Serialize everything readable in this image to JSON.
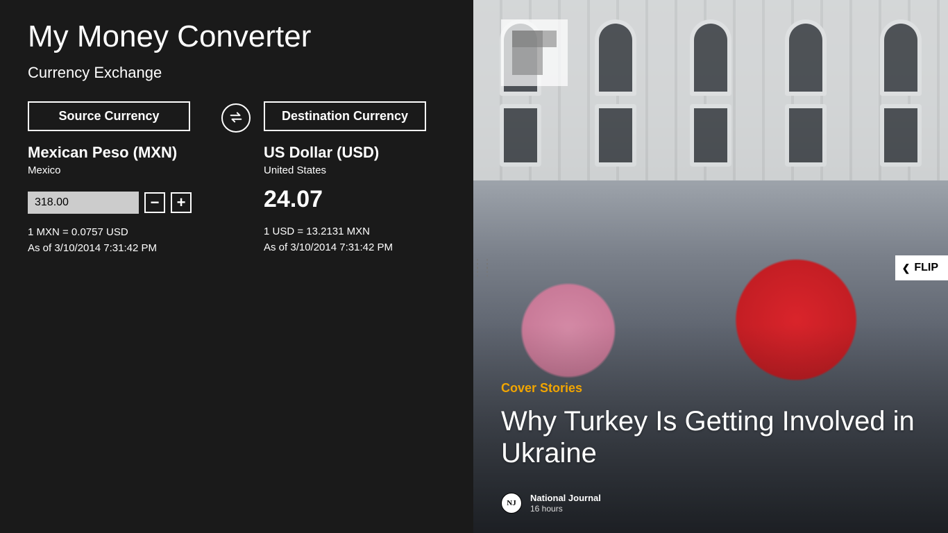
{
  "app_title": "My Money Converter",
  "subtitle": "Currency Exchange",
  "source": {
    "button_label": "Source Currency",
    "currency_name": "Mexican Peso (MXN)",
    "country": "Mexico",
    "amount": "318.00",
    "rate_line": "1 MXN = 0.0757 USD",
    "timestamp": "As of 3/10/2014 7:31:42 PM"
  },
  "dest": {
    "button_label": "Destination Currency",
    "currency_name": "US Dollar (USD)",
    "country": "United States",
    "result": "24.07",
    "rate_line": "1 USD = 13.2131 MXN",
    "timestamp": "As of 3/10/2014 7:31:42 PM"
  },
  "flipboard": {
    "flip_label": "FLIP",
    "category": "Cover Stories",
    "headline": "Why Turkey Is Getting Involved in Ukraine",
    "source_name": "National Journal",
    "source_abbrev": "NJ",
    "source_time": "16 hours"
  }
}
